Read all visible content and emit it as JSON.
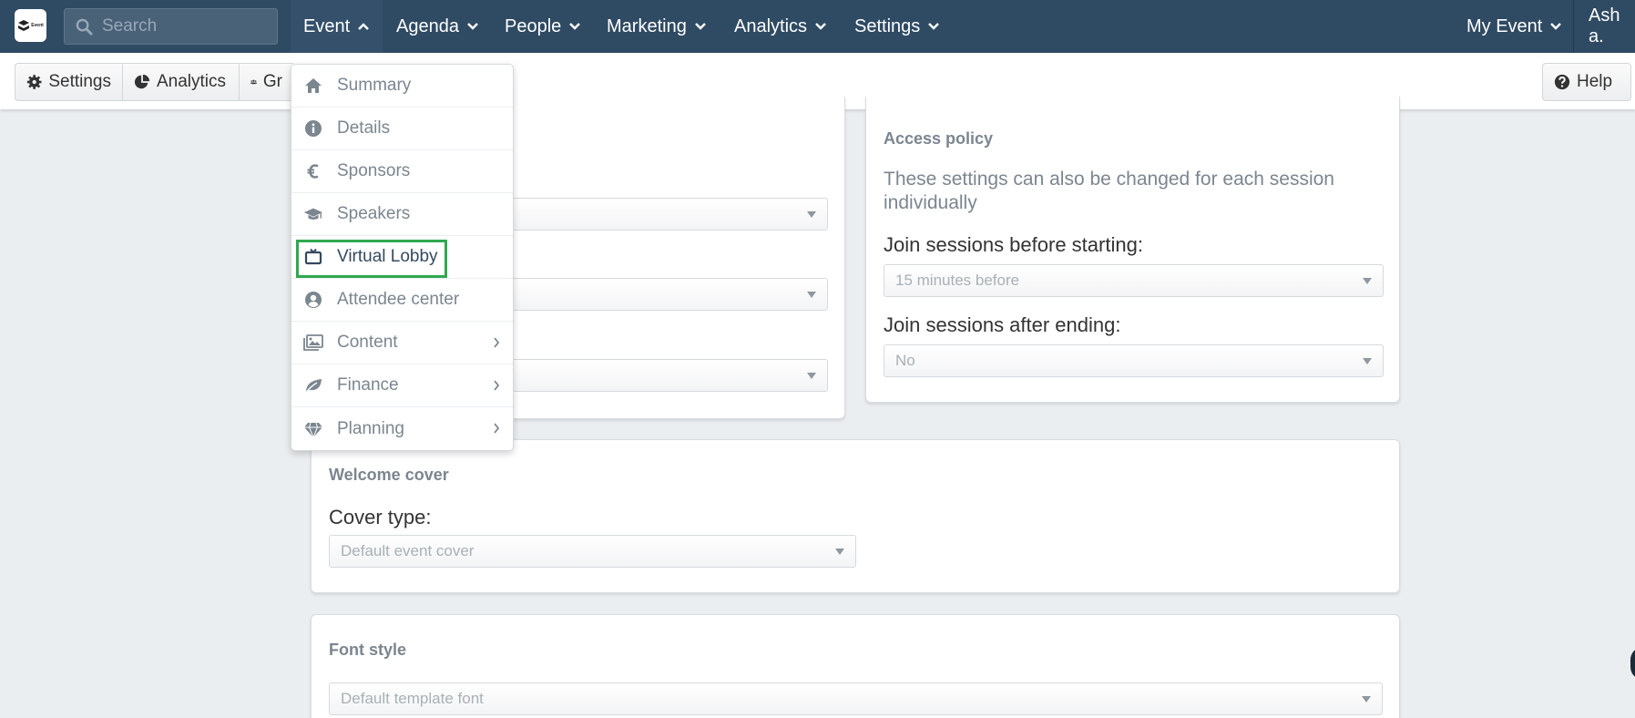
{
  "topbar": {
    "logo_text": "Event",
    "search_placeholder": "Search",
    "nav": [
      {
        "label": "Event"
      },
      {
        "label": "Agenda"
      },
      {
        "label": "People"
      },
      {
        "label": "Marketing"
      },
      {
        "label": "Analytics"
      },
      {
        "label": "Settings"
      }
    ],
    "my_event": "My Event",
    "user": "Ash a."
  },
  "subbar": {
    "settings": "Settings",
    "analytics": "Analytics",
    "groups_partial": "Gr",
    "help": "Help"
  },
  "event_menu": {
    "items": [
      {
        "label": "Summary",
        "icon": "home-icon"
      },
      {
        "label": "Details",
        "icon": "info-icon"
      },
      {
        "label": "Sponsors",
        "icon": "euro-icon"
      },
      {
        "label": "Speakers",
        "icon": "graduation-cap-icon"
      },
      {
        "label": "Virtual Lobby",
        "icon": "tv-icon"
      },
      {
        "label": "Attendee center",
        "icon": "user-circle-icon"
      },
      {
        "label": "Content",
        "icon": "images-icon"
      },
      {
        "label": "Finance",
        "icon": "leaf-icon"
      },
      {
        "label": "Planning",
        "icon": "diamond-icon"
      }
    ]
  },
  "access_policy": {
    "title": "Access policy",
    "description": "These settings can also be changed for each session individually",
    "join_before_label": "Join sessions before starting:",
    "join_before_value": "15 minutes before",
    "join_after_label": "Join sessions after ending:",
    "join_after_value": "No"
  },
  "welcome_cover": {
    "title": "Welcome cover",
    "cover_type_label": "Cover type:",
    "cover_type_value": "Default event cover"
  },
  "font_style": {
    "title": "Font style",
    "value": "Default template font"
  },
  "colors": {
    "topbar": "#2f4a63",
    "highlight": "#2fa84f",
    "muted_text": "#7b868f"
  }
}
